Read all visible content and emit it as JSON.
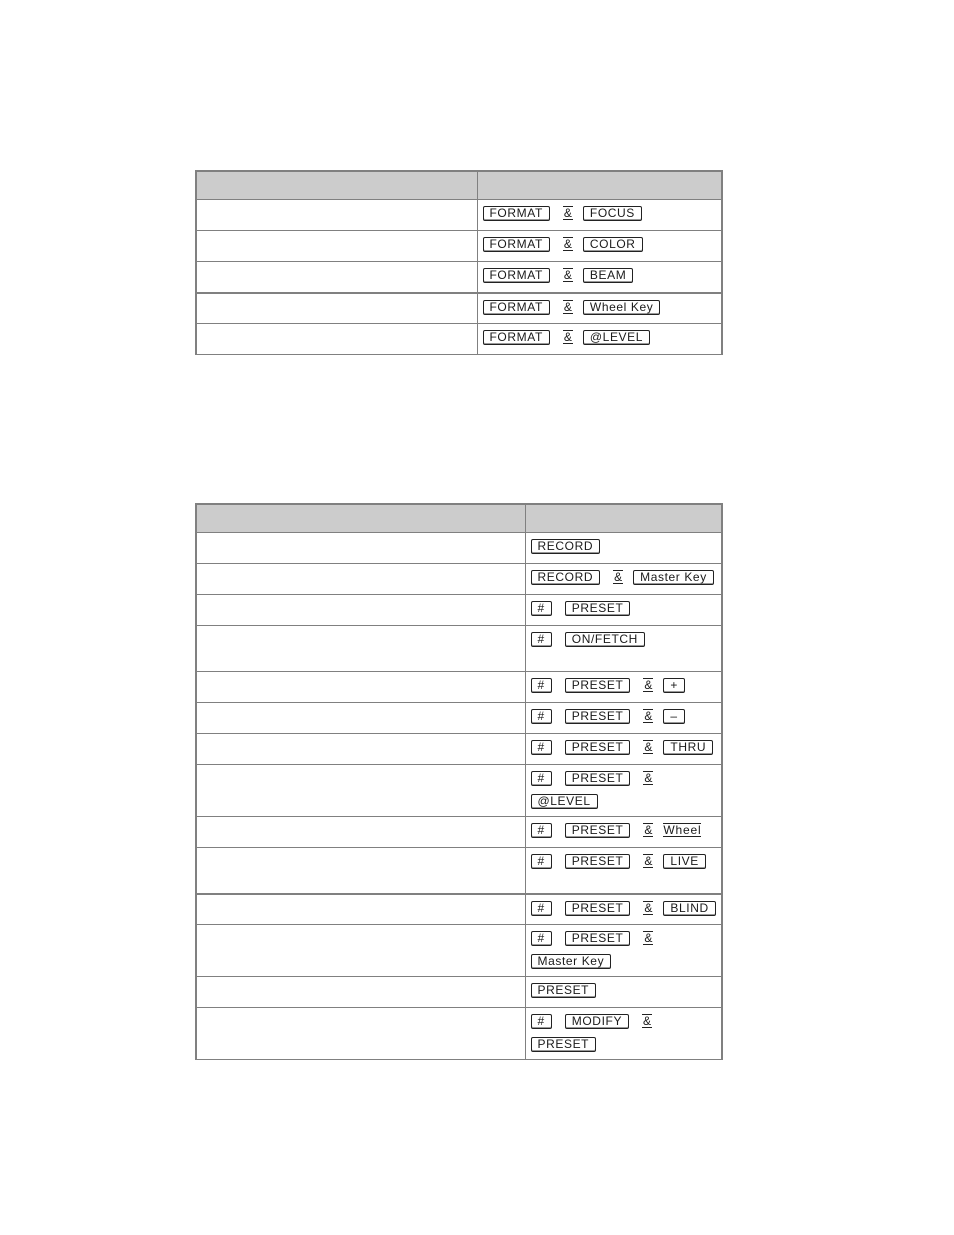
{
  "table1": {
    "headers": [
      "",
      ""
    ],
    "rows": [
      {
        "description": "",
        "keys": [
          {
            "type": "key",
            "label": "FORMAT"
          },
          {
            "type": "amp",
            "label": "&"
          },
          {
            "type": "key",
            "label": "FOCUS"
          }
        ]
      },
      {
        "description": "",
        "keys": [
          {
            "type": "key",
            "label": "FORMAT"
          },
          {
            "type": "amp",
            "label": "&"
          },
          {
            "type": "key",
            "label": "COLOR"
          }
        ]
      },
      {
        "description": "",
        "keys": [
          {
            "type": "key",
            "label": "FORMAT"
          },
          {
            "type": "amp",
            "label": "&"
          },
          {
            "type": "key",
            "label": "BEAM"
          }
        ]
      },
      {
        "description": "",
        "keys": [
          {
            "type": "key",
            "label": "FORMAT"
          },
          {
            "type": "amp",
            "label": "&"
          },
          {
            "type": "key",
            "label": "Wheel Key"
          }
        ]
      },
      {
        "description": "",
        "keys": [
          {
            "type": "key",
            "label": "FORMAT"
          },
          {
            "type": "amp",
            "label": "&"
          },
          {
            "type": "key",
            "label": "@LEVEL"
          }
        ]
      }
    ]
  },
  "table2": {
    "headers": [
      "",
      ""
    ],
    "rows": [
      {
        "description": "",
        "keys": [
          {
            "type": "key",
            "label": "RECORD"
          }
        ]
      },
      {
        "description": "",
        "keys": [
          {
            "type": "key",
            "label": "RECORD"
          },
          {
            "type": "amp",
            "label": "&"
          },
          {
            "type": "key",
            "label": "Master Key"
          }
        ]
      },
      {
        "description": "",
        "keys": [
          {
            "type": "key",
            "label": "#"
          },
          {
            "type": "key",
            "label": "PRESET"
          }
        ]
      },
      {
        "description": "",
        "keys": [
          {
            "type": "key",
            "label": "#"
          },
          {
            "type": "key",
            "label": "ON/FETCH"
          }
        ]
      },
      {
        "description": "",
        "keys": [
          {
            "type": "key",
            "label": "#"
          },
          {
            "type": "key",
            "label": "PRESET"
          },
          {
            "type": "amp",
            "label": "&"
          },
          {
            "type": "key",
            "label": "+"
          }
        ]
      },
      {
        "description": "",
        "keys": [
          {
            "type": "key",
            "label": "#"
          },
          {
            "type": "key",
            "label": "PRESET"
          },
          {
            "type": "amp",
            "label": "&"
          },
          {
            "type": "key",
            "label": "–"
          }
        ]
      },
      {
        "description": "",
        "keys": [
          {
            "type": "key",
            "label": "#"
          },
          {
            "type": "key",
            "label": "PRESET"
          },
          {
            "type": "amp",
            "label": "&"
          },
          {
            "type": "key",
            "label": "THRU"
          }
        ]
      },
      {
        "description": "",
        "keys": [
          {
            "type": "key",
            "label": "#"
          },
          {
            "type": "key",
            "label": "PRESET"
          },
          {
            "type": "amp",
            "label": "&"
          }
        ],
        "keys_line2": [
          {
            "type": "key",
            "label": "@LEVEL"
          }
        ]
      },
      {
        "description": "",
        "keys": [
          {
            "type": "key",
            "label": "#"
          },
          {
            "type": "key",
            "label": "PRESET"
          },
          {
            "type": "amp",
            "label": "&"
          },
          {
            "type": "wheel",
            "label": "Wheel"
          }
        ]
      },
      {
        "description": "",
        "keys": [
          {
            "type": "key",
            "label": "#"
          },
          {
            "type": "key",
            "label": "PRESET"
          },
          {
            "type": "amp",
            "label": "&"
          },
          {
            "type": "key",
            "label": "LIVE"
          }
        ]
      },
      {
        "description": "",
        "keys": [
          {
            "type": "key",
            "label": "#"
          },
          {
            "type": "key",
            "label": "PRESET"
          },
          {
            "type": "amp",
            "label": "&"
          },
          {
            "type": "key",
            "label": "BLIND"
          }
        ]
      },
      {
        "description": "",
        "keys": [
          {
            "type": "key",
            "label": "#"
          },
          {
            "type": "key",
            "label": "PRESET"
          },
          {
            "type": "amp",
            "label": "&"
          }
        ],
        "keys_line2": [
          {
            "type": "key",
            "label": "Master Key"
          }
        ]
      },
      {
        "description": "",
        "keys": [
          {
            "type": "key",
            "label": "PRESET"
          }
        ]
      },
      {
        "description": "",
        "keys": [
          {
            "type": "key",
            "label": "#"
          },
          {
            "type": "key",
            "label": "MODIFY"
          },
          {
            "type": "amp",
            "label": "&"
          }
        ],
        "keys_line2": [
          {
            "type": "key",
            "label": "PRESET"
          }
        ]
      }
    ]
  },
  "colors": {
    "border": "#808080",
    "header_fill": "#cccccc",
    "key_border": "#222222"
  }
}
